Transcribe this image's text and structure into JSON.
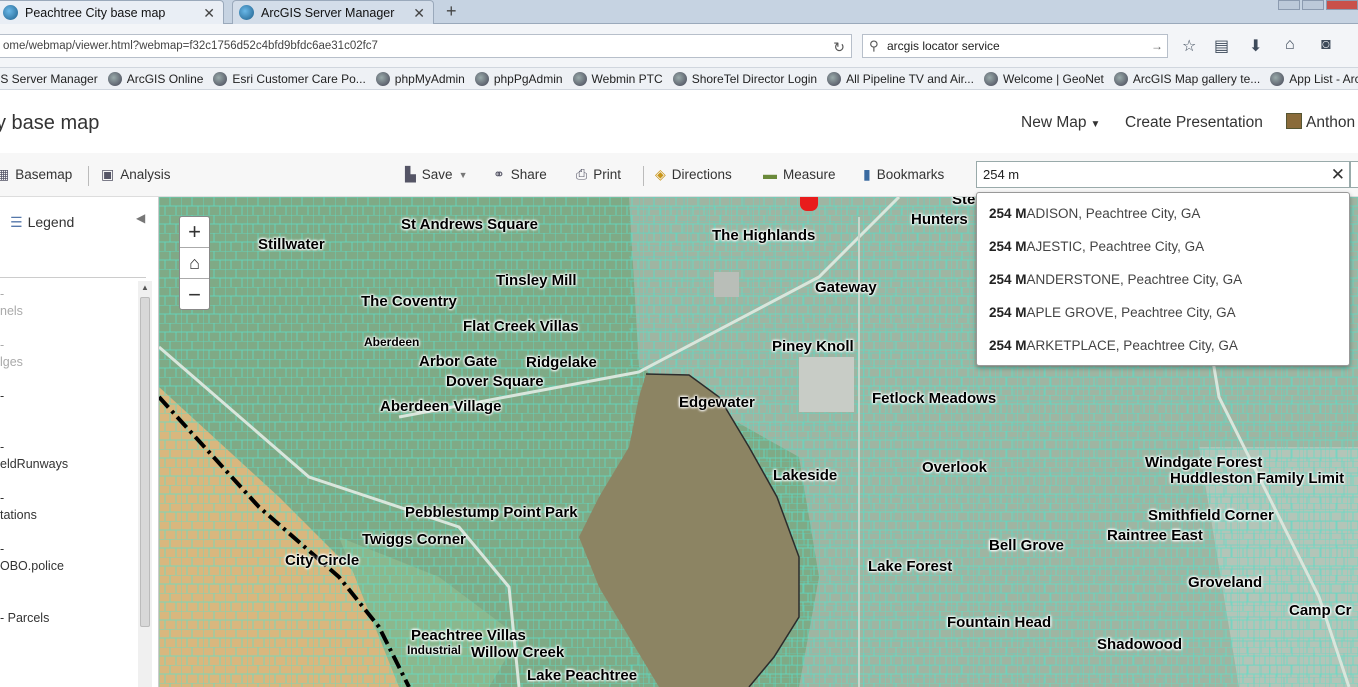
{
  "browser": {
    "tabs": [
      {
        "title": "Peachtree City base map"
      },
      {
        "title": "ArcGIS Server Manager"
      }
    ],
    "url": "ome/webmap/viewer.html?webmap=f32c1756d52c4bfd9bfdc6ae31c02fc7",
    "search_value": "arcgis locator service",
    "bookmarks": [
      "IS Server Manager",
      "ArcGIS Online",
      "Esri Customer Care Po...",
      "phpMyAdmin",
      "phpPgAdmin",
      "Webmin PTC",
      "ShoreTel Director Login",
      "All Pipeline TV and Air...",
      "Welcome | GeoNet",
      "ArcGIS Map gallery te...",
      "App List - ArcGI"
    ]
  },
  "header": {
    "map_title": "y base map",
    "new_map": "New Map",
    "create_presentation": "Create Presentation",
    "user": "Anthon"
  },
  "toolbar": {
    "basemap": "Basemap",
    "analysis": "Analysis",
    "save": "Save",
    "share": "Share",
    "print": "Print",
    "directions": "Directions",
    "measure": "Measure",
    "bookmarks": "Bookmarks",
    "search_value": "254 m"
  },
  "suggestions": [
    {
      "bold": "254 M",
      "rest": "ADISON, Peachtree City, GA"
    },
    {
      "bold": "254 M",
      "rest": "AJESTIC, Peachtree City, GA"
    },
    {
      "bold": "254 M",
      "rest": "ANDERSTONE, Peachtree City, GA"
    },
    {
      "bold": "254 M",
      "rest": "APLE GROVE, Peachtree City, GA"
    },
    {
      "bold": "254 M",
      "rest": "ARKETPLACE, Peachtree City, GA"
    }
  ],
  "sidebar": {
    "legend": "Legend",
    "layers": [
      {
        "l1": "-",
        "l2": "nels"
      },
      {
        "l1": "-",
        "l2": "lges"
      },
      {
        "l1": "-",
        "l2": ""
      },
      {
        "l1": "-",
        "l2": "eldRunways"
      },
      {
        "l1": "-",
        "l2": "tations"
      },
      {
        "l1": "-",
        "l2": "OBO.police"
      },
      {
        "l1": "- Parcels",
        "l2": ""
      }
    ]
  },
  "map": {
    "labels": [
      "Stillwater",
      "St Andrews Square",
      "The Highlands",
      "Tinsley Mill",
      "Gateway",
      "The Coventry",
      "Flat Creek Villas",
      "Aberdeen",
      "Arbor Gate",
      "Ridgelake",
      "Piney Knoll",
      "Dover Square",
      "Edgewater",
      "Fetlock Meadows",
      "Aberdeen Village",
      "Lakeside",
      "Overlook",
      "Windgate Forest",
      "Huddleston Family Limit",
      "Pebblestump Point Park",
      "Smithfield Corner",
      "Twiggs Corner",
      "Bell Grove",
      "Raintree East",
      "City Circle",
      "Lake Forest",
      "Groveland",
      "Camp Cr",
      "Fountain Head",
      "Peachtree Villas",
      "Shadowood",
      "Industrial",
      "Willow Creek",
      "Lake Peachtree",
      "Hunters",
      "Ste"
    ]
  }
}
